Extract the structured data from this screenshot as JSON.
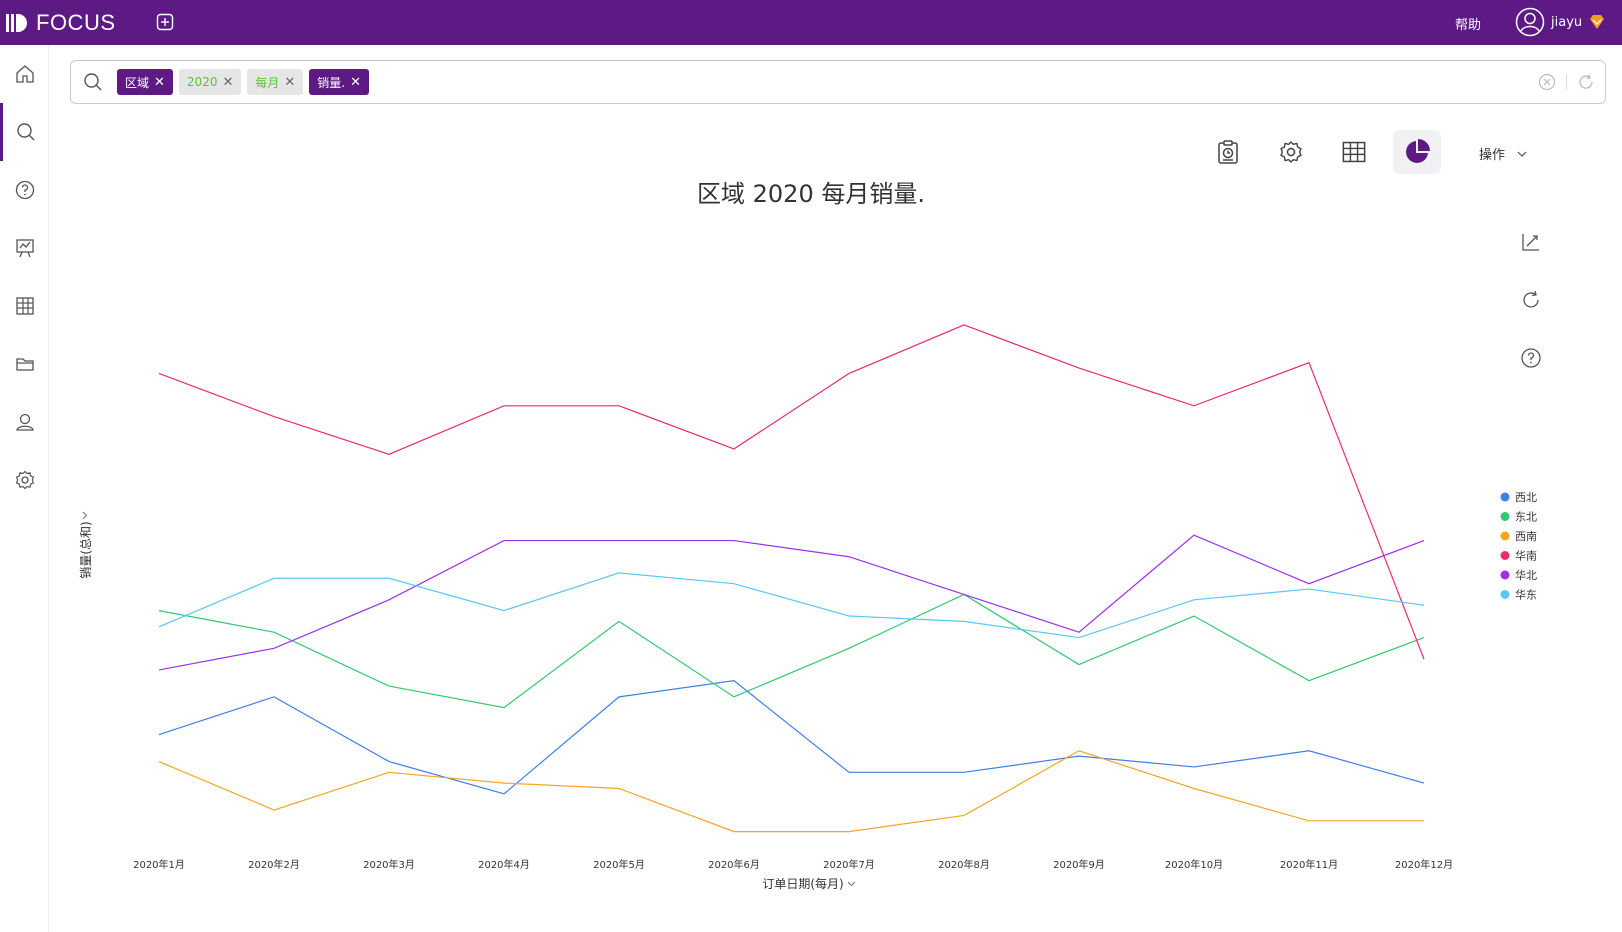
{
  "app": {
    "brand": "FOCUS",
    "help": "帮助",
    "user": "jiayu"
  },
  "search": {
    "tokens": [
      {
        "label": "区域",
        "style": "dark"
      },
      {
        "label": "2020",
        "style": "light"
      },
      {
        "label": "每月",
        "style": "light"
      },
      {
        "label": "销量.",
        "style": "dark"
      }
    ]
  },
  "toolbar": {
    "operations_label": "操作"
  },
  "colors": {
    "brand": "#5e1a84"
  },
  "chart_data": {
    "type": "line",
    "title": "区域 2020 每月销量.",
    "xlabel": "订单日期(每月)",
    "ylabel": "销量(总和)",
    "categories": [
      "2020年1月",
      "2020年2月",
      "2020年3月",
      "2020年4月",
      "2020年5月",
      "2020年6月",
      "2020年7月",
      "2020年8月",
      "2020年9月",
      "2020年10月",
      "2020年11月",
      "2020年12月"
    ],
    "ylim": [
      0,
      100
    ],
    "legend_position": "right",
    "grid": false,
    "series": [
      {
        "name": "西北",
        "color": "#3f7fe8",
        "values": [
          19,
          26,
          14,
          8,
          26,
          29,
          12,
          12,
          15,
          13,
          16,
          10
        ]
      },
      {
        "name": "东北",
        "color": "#35c86f",
        "values": [
          42,
          38,
          28,
          24,
          40,
          26,
          35,
          45,
          32,
          41,
          29,
          37
        ]
      },
      {
        "name": "西南",
        "color": "#f5a623",
        "values": [
          14,
          5,
          12,
          10,
          9,
          1,
          1,
          4,
          16,
          9,
          3,
          3
        ]
      },
      {
        "name": "华南",
        "color": "#ea2e6a",
        "values": [
          86,
          78,
          71,
          80,
          80,
          72,
          86,
          95,
          87,
          80,
          88,
          33
        ]
      },
      {
        "name": "华北",
        "color": "#9b30f0",
        "values": [
          31,
          35,
          44,
          55,
          55,
          55,
          52,
          45,
          38,
          56,
          47,
          55
        ]
      },
      {
        "name": "华东",
        "color": "#5bc8f2",
        "values": [
          39,
          48,
          48,
          42,
          49,
          47,
          41,
          40,
          37,
          44,
          46,
          43
        ]
      }
    ]
  }
}
